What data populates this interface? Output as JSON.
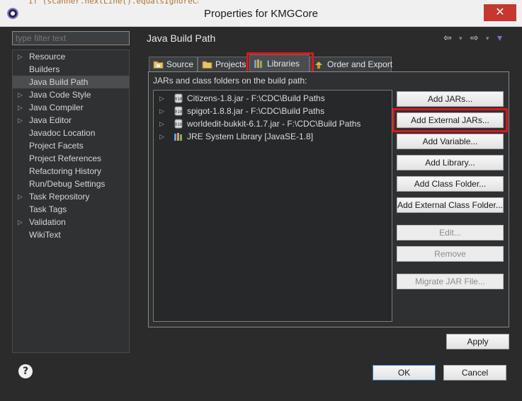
{
  "window": {
    "title": "Properties for KMGCore",
    "close_glyph": "✕",
    "code_fragment": "if (scanner.nextLine().equalsIgnoreCase(\"true\")) {"
  },
  "sidebar": {
    "filter_placeholder": "type filter text",
    "items": [
      {
        "label": "Resource",
        "expandable": true
      },
      {
        "label": "Builders",
        "expandable": false
      },
      {
        "label": "Java Build Path",
        "expandable": false,
        "selected": true
      },
      {
        "label": "Java Code Style",
        "expandable": true
      },
      {
        "label": "Java Compiler",
        "expandable": true
      },
      {
        "label": "Java Editor",
        "expandable": true
      },
      {
        "label": "Javadoc Location",
        "expandable": false
      },
      {
        "label": "Project Facets",
        "expandable": false
      },
      {
        "label": "Project References",
        "expandable": false
      },
      {
        "label": "Refactoring History",
        "expandable": false
      },
      {
        "label": "Run/Debug Settings",
        "expandable": false
      },
      {
        "label": "Task Repository",
        "expandable": true
      },
      {
        "label": "Task Tags",
        "expandable": false
      },
      {
        "label": "Validation",
        "expandable": true
      },
      {
        "label": "WikiText",
        "expandable": false
      }
    ]
  },
  "main": {
    "title": "Java Build Path",
    "nav": {
      "back": "⇦",
      "forward": "⇨",
      "dropdown": "▾",
      "menu": "▾"
    },
    "tabs": [
      {
        "label": "Source",
        "icon": "source-folder-icon"
      },
      {
        "label": "Projects",
        "icon": "projects-folder-icon"
      },
      {
        "label": "Libraries",
        "icon": "libraries-icon",
        "active": true
      },
      {
        "label": "Order and Export",
        "icon": "order-export-icon"
      }
    ],
    "list_label": "JARs and class folders on the build path:",
    "libraries": [
      {
        "label": "Citizens-1.8.jar - F:\\CDC\\Build Paths",
        "icon": "jar-icon"
      },
      {
        "label": "spigot-1.8.8.jar - F:\\CDC\\Build Paths",
        "icon": "jar-icon"
      },
      {
        "label": "worldedit-bukkit-6.1.7.jar - F:\\CDC\\Build Paths",
        "icon": "jar-icon"
      },
      {
        "label": "JRE System Library [JavaSE-1.8]",
        "icon": "jre-library-icon"
      }
    ],
    "buttons": {
      "add_jars": "Add JARs...",
      "add_external_jars": "Add External JARs...",
      "add_variable": "Add Variable...",
      "add_library": "Add Library...",
      "add_class_folder": "Add Class Folder...",
      "add_external_class_folder": "Add External Class Folder...",
      "edit": "Edit...",
      "remove": "Remove",
      "migrate_jar": "Migrate JAR File..."
    },
    "apply": "Apply"
  },
  "footer": {
    "help": "?",
    "ok": "OK",
    "cancel": "Cancel"
  },
  "colors": {
    "highlight": "#e0141b",
    "dialog_bg": "#2b2b2b",
    "selected_nav": "#4b4d50",
    "close_button": "#c7372f"
  }
}
